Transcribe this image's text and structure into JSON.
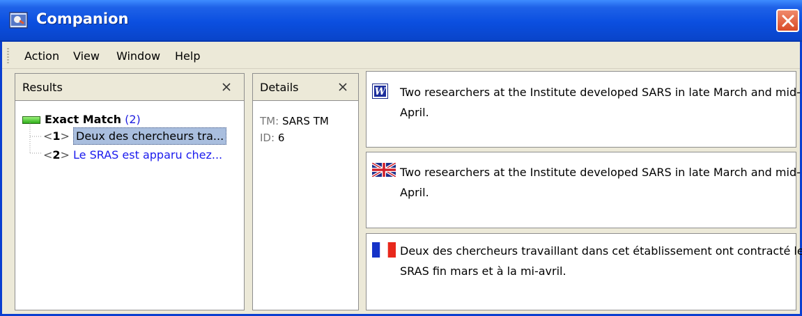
{
  "window": {
    "title": "Companion",
    "close_icon": "close-icon",
    "app_icon": "companion-app-icon"
  },
  "menu": {
    "items": [
      "Action",
      "View",
      "Window",
      "Help"
    ]
  },
  "results": {
    "title": "Results",
    "group_label": "Exact Match",
    "group_count": "(2)",
    "items": [
      {
        "index_open": "<",
        "index_num": "1",
        "index_close": ">",
        "text": "Deux des chercheurs tra...",
        "selected": true
      },
      {
        "index_open": "<",
        "index_num": "2",
        "index_close": ">",
        "text": "Le SRAS est apparu chez...",
        "selected": false
      }
    ]
  },
  "details": {
    "title": "Details",
    "tm_key": "TM:",
    "tm_value": "SARS TM",
    "id_key": "ID:",
    "id_value": "6"
  },
  "segments": [
    {
      "icon": "word-document-icon",
      "text": "Two researchers at the Institute developed SARS in late March and mid-April."
    },
    {
      "icon": "uk-flag-icon",
      "text": "Two researchers at the Institute developed SARS in late March and mid-April."
    },
    {
      "icon": "france-flag-icon",
      "text": "Deux des chercheurs travaillant dans cet établissement ont contracté le SRAS fin mars et à la mi-avril."
    }
  ]
}
